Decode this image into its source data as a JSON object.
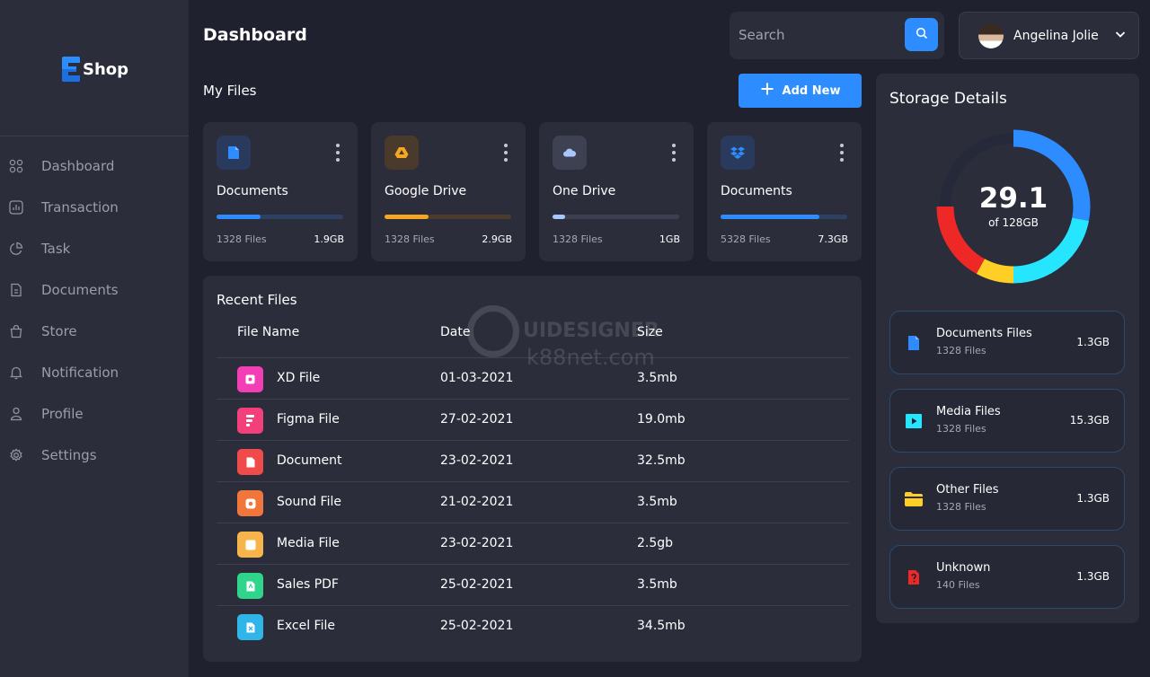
{
  "brand": {
    "name": "Shop"
  },
  "sidebar": {
    "items": [
      {
        "label": "Dashboard",
        "icon": "grid-icon"
      },
      {
        "label": "Transaction",
        "icon": "chart-icon"
      },
      {
        "label": "Task",
        "icon": "pie-icon"
      },
      {
        "label": "Documents",
        "icon": "document-icon"
      },
      {
        "label": "Store",
        "icon": "bag-icon"
      },
      {
        "label": "Notification",
        "icon": "bell-icon"
      },
      {
        "label": "Profile",
        "icon": "user-icon"
      },
      {
        "label": "Settings",
        "icon": "gear-icon"
      }
    ]
  },
  "header": {
    "title": "Dashboard",
    "search_placeholder": "Search",
    "user_name": "Angelina Jolie"
  },
  "my_files": {
    "title": "My Files",
    "add_label": "Add New",
    "cards": [
      {
        "name": "Documents",
        "files": "1328 Files",
        "size": "1.9GB",
        "progress": 0.35,
        "color": "#2d8cff",
        "track": "#2f4163",
        "icon": "document-icon"
      },
      {
        "name": "Google Drive",
        "files": "1328 Files",
        "size": "2.9GB",
        "progress": 0.35,
        "color": "#f5a623",
        "track": "#4a3b2c",
        "icon": "google-drive-icon"
      },
      {
        "name": "One Drive",
        "files": "1328 Files",
        "size": "1GB",
        "progress": 0.1,
        "color": "#a9c7ff",
        "track": "#3d4050",
        "icon": "cloud-icon"
      },
      {
        "name": "Documents",
        "files": "5328 Files",
        "size": "7.3GB",
        "progress": 0.78,
        "color": "#2d8cff",
        "track": "#2f4163",
        "icon": "dropbox-icon"
      }
    ]
  },
  "recent_files": {
    "title": "Recent Files",
    "columns": [
      "File Name",
      "Date",
      "Size"
    ],
    "rows": [
      {
        "name": "XD File",
        "date": "01-03-2021",
        "size": "3.5mb",
        "color": "#f33fb5",
        "icon": "xd-file-icon"
      },
      {
        "name": "Figma File",
        "date": "27-02-2021",
        "size": "19.0mb",
        "color": "#f33f7a",
        "icon": "figma-file-icon"
      },
      {
        "name": "Document",
        "date": "23-02-2021",
        "size": "32.5mb",
        "color": "#ef4b4b",
        "icon": "document-file-icon"
      },
      {
        "name": "Sound File",
        "date": "21-02-2021",
        "size": "3.5mb",
        "color": "#f0763b",
        "icon": "sound-file-icon"
      },
      {
        "name": "Media File",
        "date": "23-02-2021",
        "size": "2.5gb",
        "color": "#f7b44a",
        "icon": "media-file-icon"
      },
      {
        "name": "Sales PDF",
        "date": "25-02-2021",
        "size": "3.5mb",
        "color": "#2fd58a",
        "icon": "pdf-file-icon"
      },
      {
        "name": "Excel File",
        "date": "25-02-2021",
        "size": "34.5mb",
        "color": "#2fb5e8",
        "icon": "excel-file-icon"
      }
    ]
  },
  "storage": {
    "title": "Storage Details",
    "used": "29.1",
    "total_label": "of 128GB",
    "segments": [
      {
        "color": "#2d8cff",
        "from": 0,
        "to": 0.28
      },
      {
        "color": "#26e5ff",
        "from": 0.28,
        "to": 0.5
      },
      {
        "color": "#ffcf26",
        "from": 0.5,
        "to": 0.58
      },
      {
        "color": "#ee2727",
        "from": 0.58,
        "to": 0.75
      },
      {
        "color": "#26293a",
        "from": 0.75,
        "to": 1.0
      }
    ],
    "items": [
      {
        "name": "Documents Files",
        "count": "1328 Files",
        "size": "1.3GB",
        "color": "#2d8cff",
        "icon": "document-icon"
      },
      {
        "name": "Media Files",
        "count": "1328 Files",
        "size": "15.3GB",
        "color": "#26e5ff",
        "icon": "media-icon"
      },
      {
        "name": "Other Files",
        "count": "1328 Files",
        "size": "1.3GB",
        "color": "#ffcf26",
        "icon": "folder-icon"
      },
      {
        "name": "Unknown",
        "count": "140 Files",
        "size": "1.3GB",
        "color": "#ee2727",
        "icon": "unknown-file-icon"
      }
    ]
  },
  "watermark": {
    "line1": "UIDESIGNER",
    "line2": "k88net.com"
  }
}
